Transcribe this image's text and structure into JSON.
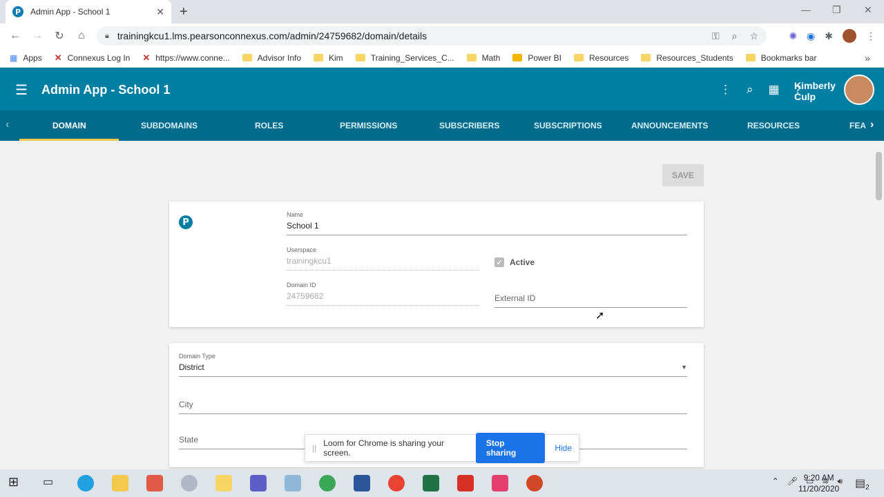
{
  "browser": {
    "tab_title": "Admin App - School 1",
    "tab_favicon": "P",
    "tab_close": "✕",
    "new_tab": "+",
    "url": "trainingkcu1.lms.pearsonconnexus.com/admin/24759682/domain/details",
    "window_controls": [
      "—",
      "❐",
      "✕"
    ]
  },
  "bookmarks": [
    {
      "label": "Apps",
      "icon": "apps-grid-icon"
    },
    {
      "label": "Connexus Log In",
      "icon": "connexus-icon"
    },
    {
      "label": "https://www.conne...",
      "icon": "connexus-icon"
    },
    {
      "label": "Advisor Info",
      "icon": "folder-icon"
    },
    {
      "label": "Kim",
      "icon": "folder-icon"
    },
    {
      "label": "Training_Services_C...",
      "icon": "folder-icon"
    },
    {
      "label": "Math",
      "icon": "folder-icon"
    },
    {
      "label": "Power BI",
      "icon": "powerbi-icon"
    },
    {
      "label": "Resources",
      "icon": "folder-icon"
    },
    {
      "label": "Resources_Students",
      "icon": "folder-icon"
    },
    {
      "label": "Bookmarks bar",
      "icon": "folder-icon"
    }
  ],
  "app": {
    "title": "Admin App - School 1",
    "user_first": "Kimberly",
    "user_last": "Culp",
    "accent": "#007fa3"
  },
  "tabs": [
    {
      "label": "DOMAIN",
      "active": true
    },
    {
      "label": "SUBDOMAINS"
    },
    {
      "label": "ROLES"
    },
    {
      "label": "PERMISSIONS"
    },
    {
      "label": "SUBSCRIBERS"
    },
    {
      "label": "SUBSCRIPTIONS"
    },
    {
      "label": "ANNOUNCEMENTS"
    },
    {
      "label": "RESOURCES"
    },
    {
      "label": "FEA"
    }
  ],
  "form": {
    "save_label": "SAVE",
    "logo": "P",
    "name_label": "Name",
    "name_value": "School 1",
    "userspace_label": "Userspace",
    "userspace_value": "trainingkcu1",
    "active_label": "Active",
    "domain_id_label": "Domain ID",
    "domain_id_value": "24759682",
    "external_id_placeholder": "External ID",
    "domain_type_label": "Domain Type",
    "domain_type_value": "District",
    "city_placeholder": "City",
    "state_placeholder": "State"
  },
  "loom": {
    "message": "Loom for Chrome is sharing your screen.",
    "stop_label": "Stop sharing",
    "hide_label": "Hide"
  },
  "taskbar": {
    "time": "9:20 AM",
    "date": "11/20/2020",
    "notifications": "2"
  }
}
